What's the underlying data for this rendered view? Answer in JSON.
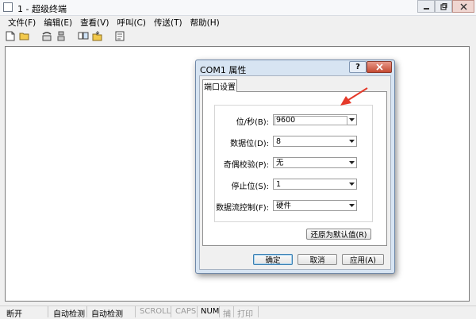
{
  "window": {
    "title": "1 - 超级终端"
  },
  "menu": [
    "文件(F)",
    "编辑(E)",
    "查看(V)",
    "呼叫(C)",
    "传送(T)",
    "帮助(H)"
  ],
  "status": {
    "connection": "断开",
    "detect1": "自动检测",
    "detect2": "自动检测",
    "scroll": "SCROLL",
    "caps": "CAPS",
    "num": "NUM",
    "capture": "捕",
    "print": "打印"
  },
  "dialog": {
    "title": "COM1 属性",
    "help": "?",
    "tab": "端口设置",
    "fields": [
      {
        "label": "位/秒(B):",
        "value": "9600"
      },
      {
        "label": "数据位(D):",
        "value": "8"
      },
      {
        "label": "奇偶校验(P):",
        "value": "无"
      },
      {
        "label": "停止位(S):",
        "value": "1"
      },
      {
        "label": "数据流控制(F):",
        "value": "硬件"
      }
    ],
    "restore_button": "还原为默认值(R)",
    "ok_button": "确定",
    "cancel_button": "取消",
    "apply_button": "应用(A)"
  },
  "colors": {
    "annotation_arrow": "#e53a2a",
    "dialog_frame": "#d7e4f2",
    "close_button": "#c54a32"
  }
}
